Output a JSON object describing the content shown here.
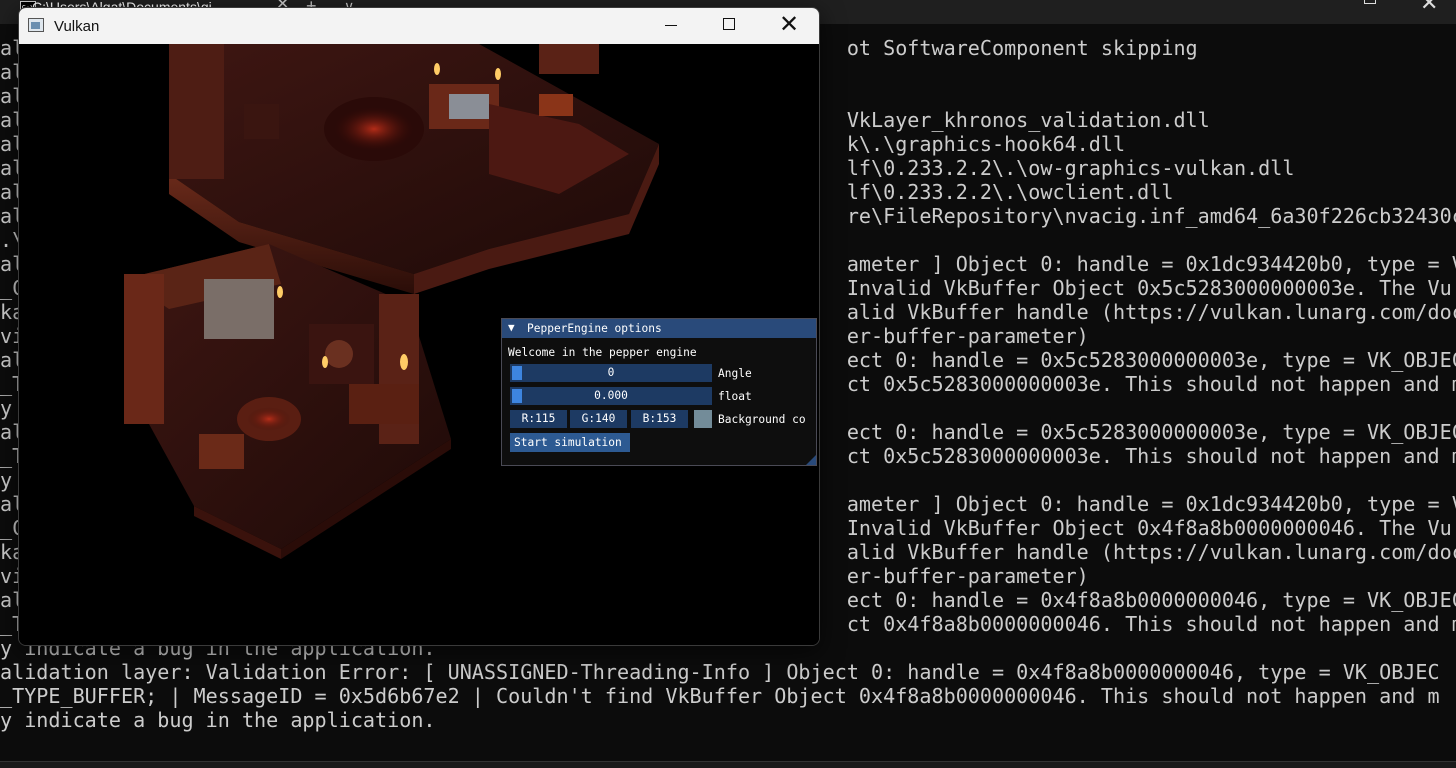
{
  "terminal": {
    "tab_title": "C:\\Users\\Algat\\Documents\\gi",
    "lines": [
      "al                                                                    ot SoftwareComponent skipping",
      "al",
      "al",
      "al                                                                    VkLayer_khronos_validation.dll",
      "al                                                                    k\\.\\graphics-hook64.dll",
      "al                                                                    lf\\0.233.2.2\\.\\ow-graphics-vulkan.dll",
      "al                                                                    lf\\0.233.2.2\\.\\owclient.dll",
      "al                                                                    re\\FileRepository\\nvacig.inf_amd64_6a30f226cb32430c",
      ".\\",
      "al                                                                    ameter ] Object 0: handle = 0x1dc934420b0, type = V",
      "_C                                                                    Invalid VkBuffer Object 0x5c5283000000003e. The Vu",
      "ka                                                                    alid VkBuffer handle (https://vulkan.lunarg.com/doc",
      "vi                                                                    er-buffer-parameter)",
      "al                                                                    ect 0: handle = 0x5c5283000000003e, type = VK_OBJEC",
      "_T                                                                    ct 0x5c5283000000003e. This should not happen and m",
      "y",
      "al                                                                    ect 0: handle = 0x5c5283000000003e, type = VK_OBJEC",
      "_T                                                                    ct 0x5c5283000000003e. This should not happen and m",
      "y",
      "al                                                                    ameter ] Object 0: handle = 0x1dc934420b0, type = V",
      "_C                                                                    Invalid VkBuffer Object 0x4f8a8b0000000046. The Vu",
      "ka                                                                    alid VkBuffer handle (https://vulkan.lunarg.com/doc",
      "vi                                                                    er-buffer-parameter)",
      "al                                                                    ect 0: handle = 0x4f8a8b0000000046, type = VK_OBJEC",
      "_T                                                                    ct 0x4f8a8b0000000046. This should not happen and m",
      "y indicate a bug in the application.",
      "alidation layer: Validation Error: [ UNASSIGNED-Threading-Info ] Object 0: handle = 0x4f8a8b0000000046, type = VK_OBJEC",
      "_TYPE_BUFFER; | MessageID = 0x5d6b67e2 | Couldn't find VkBuffer Object 0x4f8a8b0000000046. This should not happen and m",
      "y indicate a bug in the application."
    ],
    "icon": "terminal-icon",
    "new_tab_glyph": "+",
    "dropdown_glyph": "∨",
    "close_glyph": "✕"
  },
  "vulkan_window": {
    "title": "Vulkan",
    "close_glyph": "✕"
  },
  "imgui": {
    "title": "PepperEngine options",
    "collapse_glyph": "▼",
    "welcome": "Welcome in the pepper engine",
    "angle_value": "0",
    "angle_label": "Angle",
    "float_value": "0.000",
    "float_label": "float",
    "r_value": "R:115",
    "g_value": "G:140",
    "b_value": "B:153",
    "background_label": "Background co",
    "background_color": "#738c99",
    "start_button": "Start simulation",
    "accent": "#294a7a"
  }
}
